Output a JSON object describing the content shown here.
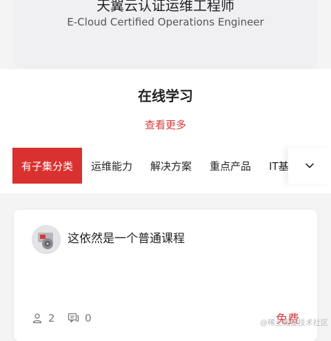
{
  "header": {
    "cert_title": "天翼云认证运维工程师",
    "cert_subtitle": "E-Cloud Certified Operations Engineer"
  },
  "section": {
    "title": "在线学习",
    "more_label": "查看更多"
  },
  "tabs": [
    {
      "label": "有子集分类",
      "active": true
    },
    {
      "label": "运维能力",
      "active": false
    },
    {
      "label": "解决方案",
      "active": false
    },
    {
      "label": "重点产品",
      "active": false
    },
    {
      "label": "IT基",
      "active": false
    }
  ],
  "tabs_more_icon": "chevron-down-icon",
  "course": {
    "title": "这依然是一个普通课程",
    "users": "2",
    "comments": "0",
    "price": "免费"
  },
  "watermark": "@稀土掘金技术社区",
  "colors": {
    "accent": "#d9312f",
    "price": "#d83a3a",
    "background": "#f4f4f4"
  }
}
